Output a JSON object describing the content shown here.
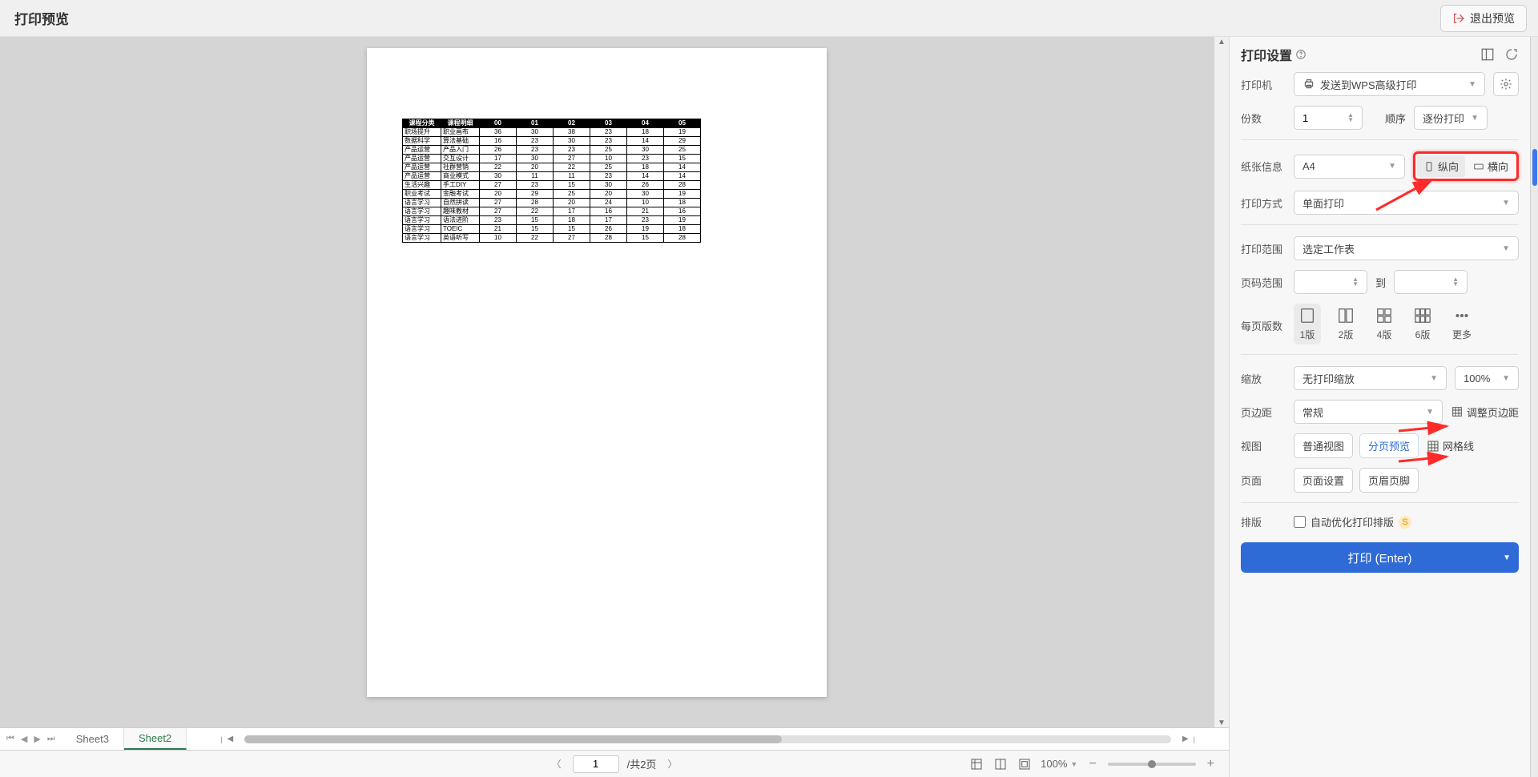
{
  "header": {
    "title": "打印预览",
    "exit_label": "退出预览"
  },
  "panel": {
    "title": "打印设置",
    "printer": {
      "label": "打印机",
      "value": "发送到WPS高级打印"
    },
    "copies": {
      "label": "份数",
      "value": "1",
      "order_label": "顺序",
      "order_value": "逐份打印"
    },
    "paper": {
      "label": "纸张信息",
      "value": "A4",
      "portrait": "纵向",
      "landscape": "横向"
    },
    "method": {
      "label": "打印方式",
      "value": "单面打印"
    },
    "range": {
      "label": "打印范围",
      "value": "选定工作表"
    },
    "pages": {
      "label": "页码范围",
      "from": "",
      "to_label": "到",
      "to": ""
    },
    "per_page": {
      "label": "每页版数",
      "options": [
        "1版",
        "2版",
        "4版",
        "6版",
        "更多"
      ]
    },
    "scale": {
      "label": "缩放",
      "value": "无打印缩放",
      "percent": "100%"
    },
    "margin": {
      "label": "页边距",
      "value": "常规",
      "adjust": "调整页边距"
    },
    "view": {
      "label": "视图",
      "normal": "普通视图",
      "paged": "分页预览",
      "grid": "网格线"
    },
    "page": {
      "label": "页面",
      "setup": "页面设置",
      "header_footer": "页眉页脚"
    },
    "layout": {
      "label": "排版",
      "auto": "自动优化打印排版"
    },
    "print_button": "打印 (Enter)"
  },
  "sheets": {
    "items": [
      "Sheet3",
      "Sheet2"
    ],
    "active_index": 1
  },
  "page_nav": {
    "current": "1",
    "total_label": "/共2页",
    "zoom": "100%"
  },
  "table": {
    "headers": [
      "课程分类",
      "课程明细",
      "00",
      "01",
      "02",
      "03",
      "04",
      "05"
    ],
    "rows": [
      [
        "职场提升",
        "职业画布",
        "36",
        "30",
        "38",
        "23",
        "18",
        "19"
      ],
      [
        "数据科学",
        "算法基础",
        "16",
        "23",
        "30",
        "23",
        "14",
        "29"
      ],
      [
        "产品运营",
        "产品入门",
        "26",
        "23",
        "23",
        "25",
        "30",
        "25"
      ],
      [
        "产品运营",
        "交互设计",
        "17",
        "30",
        "27",
        "10",
        "23",
        "15"
      ],
      [
        "产品运营",
        "社群营销",
        "22",
        "20",
        "22",
        "25",
        "18",
        "14"
      ],
      [
        "产品运营",
        "商业模式",
        "30",
        "11",
        "11",
        "23",
        "14",
        "14"
      ],
      [
        "生活兴趣",
        "手工DIY",
        "27",
        "23",
        "15",
        "30",
        "26",
        "28"
      ],
      [
        "职业考试",
        "金融考试",
        "20",
        "29",
        "25",
        "20",
        "30",
        "19"
      ],
      [
        "语言学习",
        "自然拼读",
        "27",
        "28",
        "20",
        "24",
        "10",
        "18"
      ],
      [
        "语言学习",
        "趣味教材",
        "27",
        "22",
        "17",
        "16",
        "21",
        "16"
      ],
      [
        "语言学习",
        "语法进阶",
        "23",
        "15",
        "18",
        "17",
        "23",
        "19"
      ],
      [
        "语言学习",
        "TOEIC",
        "21",
        "15",
        "15",
        "26",
        "19",
        "18"
      ],
      [
        "语言学习",
        "英语听写",
        "10",
        "22",
        "27",
        "28",
        "15",
        "28"
      ]
    ]
  }
}
